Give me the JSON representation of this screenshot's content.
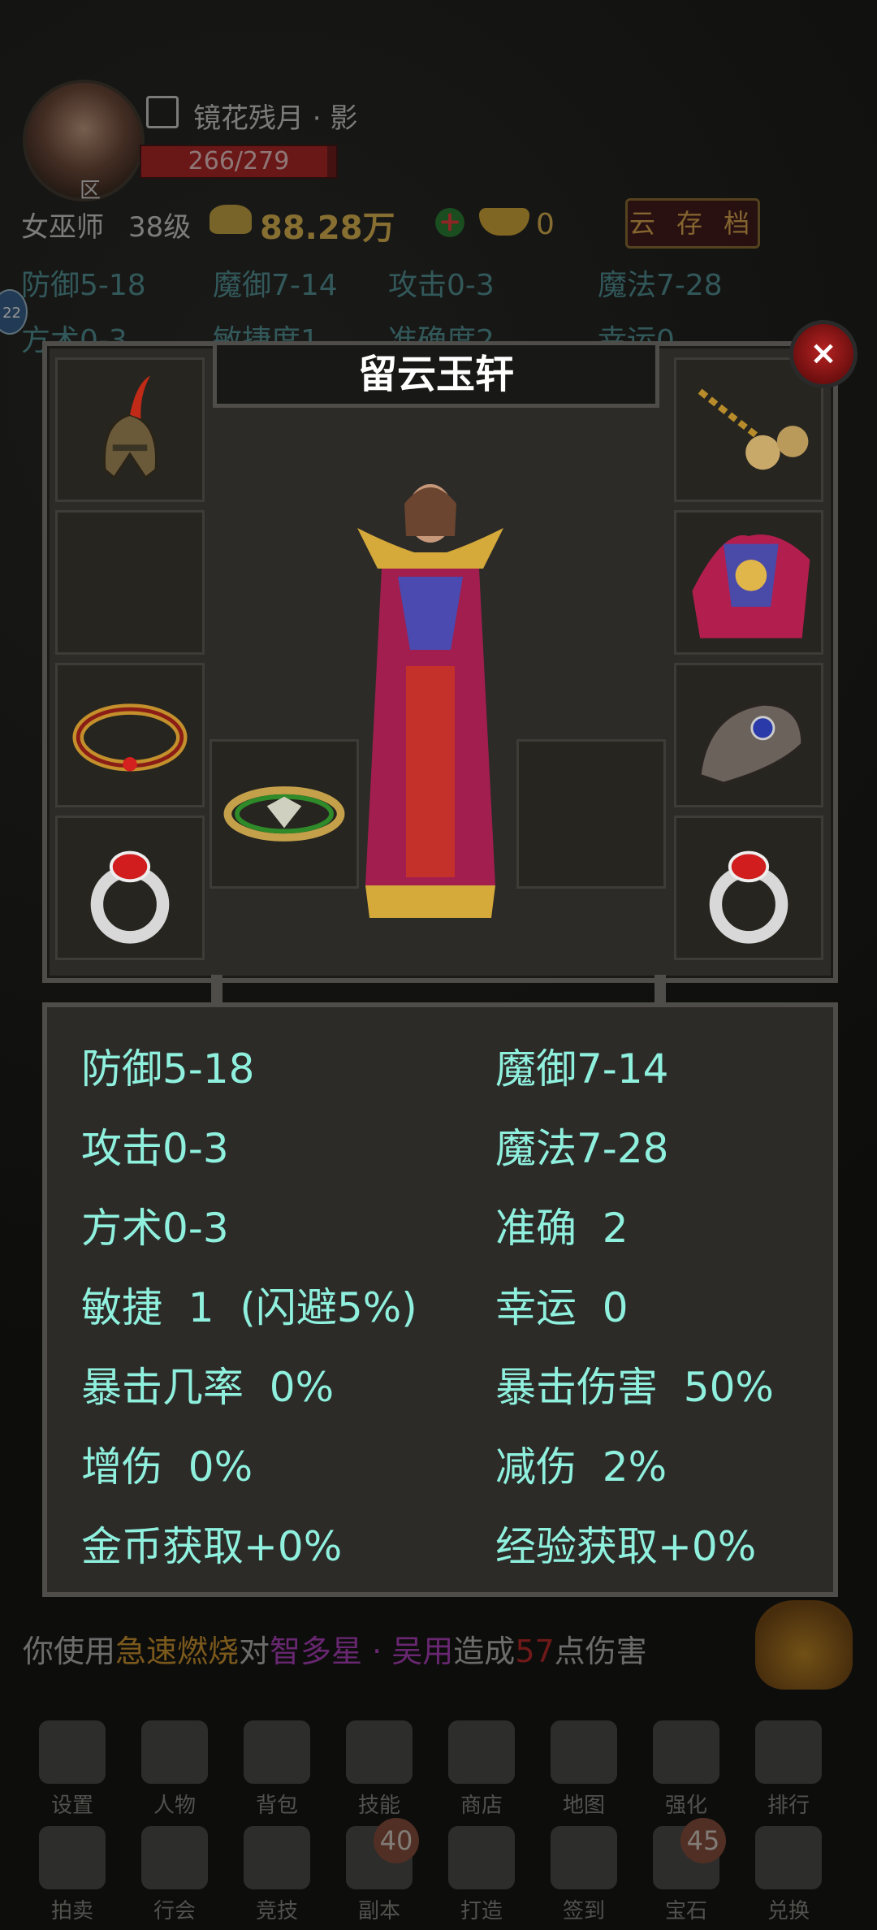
{
  "header": {
    "player_name": "镜花残月 · 影",
    "zone_label": "区",
    "hp_text": "266/279",
    "hp_fraction": 0.953,
    "class_name": "女巫师",
    "level": "38级",
    "gold": "88.28万",
    "ingot": "0",
    "cloud_save_label": "云 存 档",
    "side_badge": "22",
    "bg_stats_row1": [
      "防御5-18",
      "魔御7-14",
      "攻击0-3",
      "魔法7-28"
    ],
    "bg_stats_row2": [
      "方术0-3",
      "敏捷度1",
      "准确度2",
      "幸运0"
    ]
  },
  "equip_panel": {
    "title": "留云玉轩",
    "close_label": "×",
    "slots": [
      {
        "name": "helmet",
        "icon": "helmet-icon"
      },
      {
        "name": "necklace",
        "icon": "bell-necklace-icon"
      },
      {
        "name": "empty-left-2",
        "icon": ""
      },
      {
        "name": "armor",
        "icon": "robe-armor-icon"
      },
      {
        "name": "bracelet-left",
        "icon": "ruby-bracelet-icon"
      },
      {
        "name": "gauntlet",
        "icon": "claw-gauntlet-icon"
      },
      {
        "name": "belt",
        "icon": "jade-ring-icon"
      },
      {
        "name": "ring-left",
        "icon": "ruby-ring-icon"
      },
      {
        "name": "ring-right",
        "icon": "ruby-ring-icon"
      }
    ]
  },
  "stats": {
    "left": [
      "防御5-18",
      "攻击0-3",
      "方术0-3",
      "敏捷  1  (闪避5%)",
      "暴击几率  0%",
      "增伤  0%",
      "金币获取+0%"
    ],
    "right": [
      "魔御7-14",
      "魔法7-28",
      "准确  2",
      "幸运  0",
      "暴击伤害  50%",
      "减伤  2%",
      "经验获取+0%"
    ]
  },
  "combat_log": {
    "prefix": "你使用",
    "skill": "急速燃烧",
    "mid": "对",
    "target": "智多星 · 吴用",
    "mid2": "造成",
    "damage": "57",
    "suffix": "点伤害"
  },
  "menu_row1": [
    {
      "label": "设置",
      "icon": "gear-icon"
    },
    {
      "label": "人物",
      "icon": "armor-icon"
    },
    {
      "label": "背包",
      "icon": "bag-icon"
    },
    {
      "label": "技能",
      "icon": "sword-icon"
    },
    {
      "label": "商店",
      "icon": "shop-icon"
    },
    {
      "label": "地图",
      "icon": "map-icon"
    },
    {
      "label": "强化",
      "icon": "hammer-icon"
    },
    {
      "label": "排行",
      "icon": "ranking-icon"
    }
  ],
  "menu_row2": [
    {
      "label": "拍卖",
      "icon": "auction-icon",
      "badge": ""
    },
    {
      "label": "行会",
      "icon": "guild-icon",
      "badge": ""
    },
    {
      "label": "竞技",
      "icon": "crossed-swords-icon",
      "badge": ""
    },
    {
      "label": "副本",
      "icon": "scroll-icon",
      "badge": "40"
    },
    {
      "label": "打造",
      "icon": "anvil-icon",
      "badge": ""
    },
    {
      "label": "签到",
      "icon": "calendar-icon",
      "badge": ""
    },
    {
      "label": "宝石",
      "icon": "gem-icon",
      "badge": "45"
    },
    {
      "label": "兑换",
      "icon": "gift-icon",
      "badge": ""
    }
  ]
}
